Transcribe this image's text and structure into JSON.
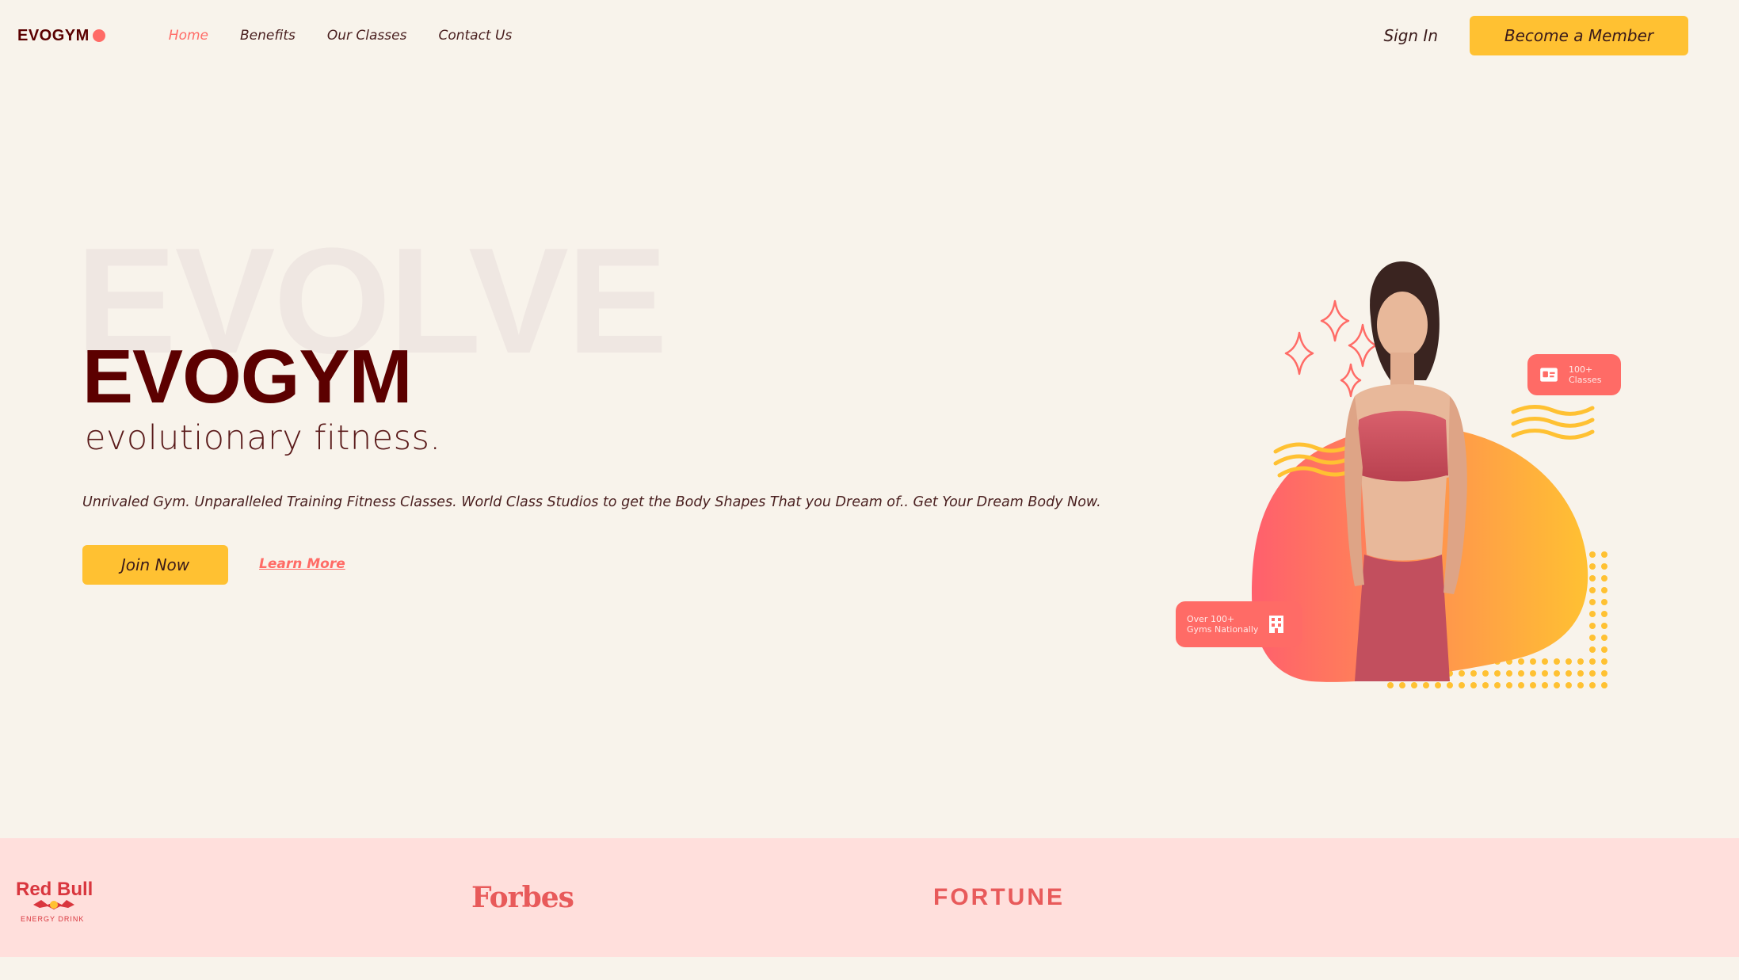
{
  "brand": {
    "name": "EVOGYM",
    "accent": "#ff6b66",
    "primary": "#ffc132",
    "dark": "#5c0000",
    "background": "#f8f3eb"
  },
  "nav": {
    "links": [
      {
        "label": "Home",
        "active": true
      },
      {
        "label": "Benefits",
        "active": false
      },
      {
        "label": "Our Classes",
        "active": false
      },
      {
        "label": "Contact Us",
        "active": false
      }
    ],
    "sign_in": "Sign In",
    "cta": "Become a Member"
  },
  "hero": {
    "background_word": "EVOLVE",
    "title": "EVOGYM",
    "subtitle": "evolutionary fitness.",
    "description": "Unrivaled Gym. Unparalleled Training Fitness Classes. World Class Studios to get the Body Shapes That you Dream of.. Get Your Dream Body Now.",
    "primary_button": "Join Now",
    "secondary_link": "Learn More"
  },
  "stats": {
    "classes": {
      "line1": "100+",
      "line2": "Classes",
      "icon": "id-card-icon"
    },
    "gyms": {
      "line1": "Over 100+",
      "line2": "Gyms Nationally",
      "icon": "building-icon"
    }
  },
  "sponsors": {
    "redbull": {
      "name": "Red Bull",
      "tagline": "ENERGY DRINK"
    },
    "forbes": "Forbes",
    "fortune": "FORTUNE"
  }
}
